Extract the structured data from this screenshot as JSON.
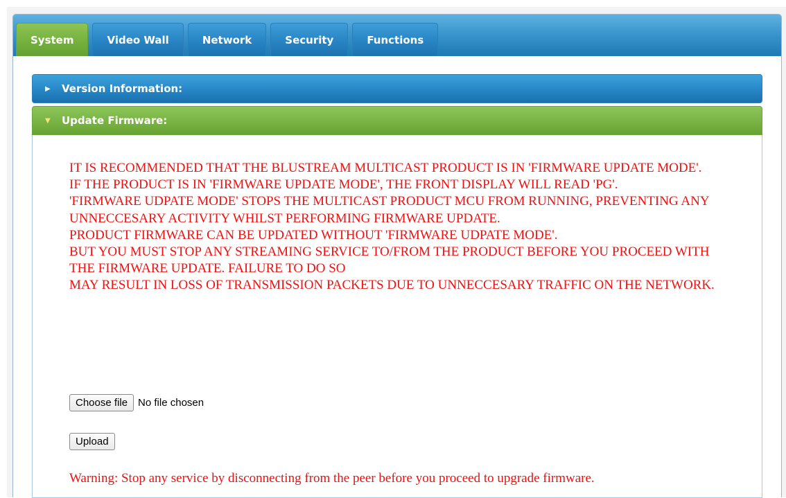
{
  "tabs": [
    {
      "label": "System",
      "active": true
    },
    {
      "label": "Video Wall",
      "active": false
    },
    {
      "label": "Network",
      "active": false
    },
    {
      "label": "Security",
      "active": false
    },
    {
      "label": "Functions",
      "active": false
    }
  ],
  "accordion": {
    "version_info": {
      "title": "Version Information:",
      "icon": "triangle-right-icon"
    },
    "update_firmware": {
      "title": "Update Firmware:",
      "icon": "triangle-down-icon"
    }
  },
  "firmware": {
    "notice_lines": [
      "IT IS RECOMMENDED THAT THE BLUSTREAM MULTICAST PRODUCT IS IN 'FIRMWARE UPDATE MODE'.",
      "IF THE PRODUCT IS IN 'FIRMWARE UPDATE MODE', THE FRONT DISPLAY WILL READ 'PG'.",
      "'FIRMWARE UDPATE MODE' STOPS THE MULTICAST PRODUCT MCU FROM RUNNING, PREVENTING ANY UNNECCESARY ACTIVITY WHILST PERFORMING FIRMWARE UPDATE.",
      "PRODUCT FIRMWARE CAN BE UPDATED WITHOUT 'FIRMWARE UDPATE MODE'.",
      "BUT YOU MUST STOP ANY STREAMING SERVICE TO/FROM THE PRODUCT BEFORE YOU PROCEED WITH THE FIRMWARE UPDATE. FAILURE TO DO SO",
      "MAY RESULT IN LOSS OF TRANSMISSION PACKETS DUE TO UNNECCESARY TRAFFIC ON THE NETWORK."
    ],
    "choose_file_label": "Choose file",
    "file_status": "No file chosen",
    "upload_label": "Upload",
    "warning": "Warning: Stop any service by disconnecting from the peer before you proceed to upgrade firmware."
  },
  "colors": {
    "tab_bar_blue": "#2a86c6",
    "active_tab_green": "#76b13e",
    "notice_red": "#ee1111"
  }
}
